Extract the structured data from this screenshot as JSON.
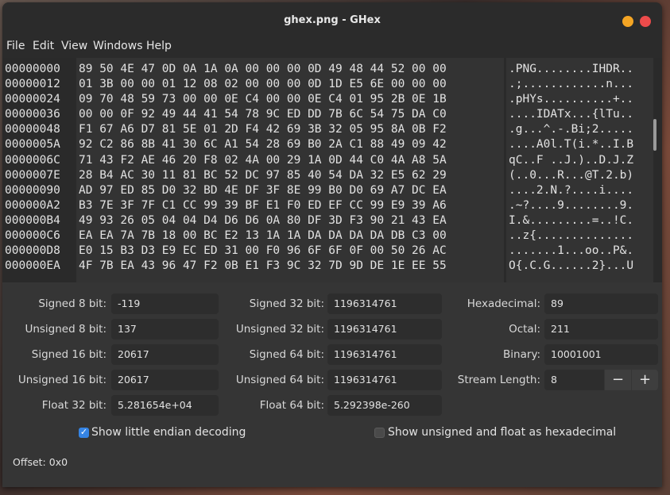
{
  "window": {
    "title": "ghex.png - GHex"
  },
  "menu": [
    "File",
    "Edit",
    "View",
    "Windows",
    "Help"
  ],
  "hex_view": {
    "offsets": [
      "00000000",
      "00000012",
      "00000024",
      "00000036",
      "00000048",
      "0000005A",
      "0000006C",
      "0000007E",
      "00000090",
      "000000A2",
      "000000B4",
      "000000C6",
      "000000D8",
      "000000EA"
    ],
    "hex_lines": [
      "89 50 4E 47 0D 0A 1A 0A 00 00 00 0D 49 48 44 52 00 00",
      "01 3B 00 00 01 12 08 02 00 00 00 0D 1D E5 6E 00 00 00",
      "09 70 48 59 73 00 00 0E C4 00 00 0E C4 01 95 2B 0E 1B",
      "00 00 0F 92 49 44 41 54 78 9C ED DD 7B 6C 54 75 DA C0",
      "F1 67 A6 D7 81 5E 01 2D F4 42 69 3B 32 05 95 8A 0B F2",
      "92 C2 86 8B 41 30 6C A1 54 28 69 B0 2A C1 88 49 09 42",
      "71 43 F2 AE 46 20 F8 02 4A 00 29 1A 0D 44 C0 4A A8 5A",
      "28 B4 AC 30 11 81 BC 52 DC 97 85 40 54 DA 32 E5 62 29",
      "AD 97 ED 85 D0 32 BD 4E DF 3F 8E 99 B0 D0 69 A7 DC EA",
      "B3 7E 3F 7F C1 CC 99 39 BF E1 F0 ED EF CC 99 E9 39 A6",
      "49 93 26 05 04 04 D4 D6 D6 0A 80 DF 3D F3 90 21 43 EA",
      "EA EA 7A 7B 18 00 BC E2 13 1A 1A DA DA DA DA DB C3 00",
      "E0 15 B3 D3 E9 EC ED 31 00 F0 96 6F 6F 0F 00 50 26 AC",
      "4F 7B EA 43 96 47 F2 0B E1 F3 9C 32 7D 9D DE 1E EE 55"
    ],
    "ascii_lines": [
      ".PNG........IHDR..",
      ".;............n...",
      ".pHYs..........+..",
      "....IDATx...{lTu..",
      ".g...^.-.Bi;2.....",
      "....A0l.T(i.*..I.B",
      "qC..F ..J.)..D.J.Z",
      "(..0...R...@T.2.b)",
      "....2.N.?....i....",
      ".~?....9........9.",
      "I.&.........=..!C.",
      "..z{..............",
      ".......1...oo..P&.",
      "O{.C.G......2}...U"
    ]
  },
  "decoder": {
    "signed8": {
      "label": "Signed 8 bit:",
      "value": "-119"
    },
    "unsigned8": {
      "label": "Unsigned 8 bit:",
      "value": "137"
    },
    "signed16": {
      "label": "Signed 16 bit:",
      "value": "20617"
    },
    "unsigned16": {
      "label": "Unsigned 16 bit:",
      "value": "20617"
    },
    "float32": {
      "label": "Float 32 bit:",
      "value": "5.281654e+04"
    },
    "signed32": {
      "label": "Signed 32 bit:",
      "value": "1196314761"
    },
    "unsigned32": {
      "label": "Unsigned 32 bit:",
      "value": "1196314761"
    },
    "signed64": {
      "label": "Signed 64 bit:",
      "value": "1196314761"
    },
    "unsigned64": {
      "label": "Unsigned 64 bit:",
      "value": "1196314761"
    },
    "float64": {
      "label": "Float 64 bit:",
      "value": "5.292398e-260"
    },
    "hexadecimal": {
      "label": "Hexadecimal:",
      "value": "89"
    },
    "octal": {
      "label": "Octal:",
      "value": "211"
    },
    "binary": {
      "label": "Binary:",
      "value": "10001001"
    },
    "stream_length": {
      "label": "Stream Length:",
      "value": "8",
      "minus": "−",
      "plus": "+"
    }
  },
  "options": {
    "little_endian": {
      "label": "Show little endian decoding",
      "checked": true
    },
    "unsigned_hex": {
      "label": "Show unsigned and float as hexadecimal",
      "checked": false
    }
  },
  "status": {
    "offset": "Offset: 0x0"
  }
}
